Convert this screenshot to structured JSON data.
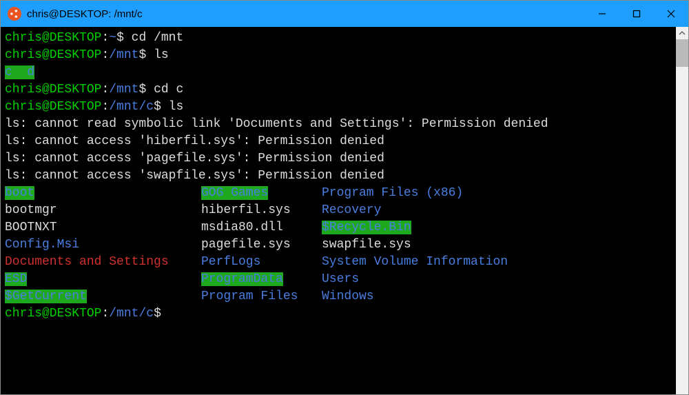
{
  "titlebar": {
    "title": "chris@DESKTOP: /mnt/c"
  },
  "prompts": {
    "p1_userhost": "chris@DESKTOP",
    "p1_sep": ":",
    "p1_path": "~",
    "p1_dollar": "$ ",
    "p1_cmd": "cd /mnt",
    "p2_path": "/mnt",
    "p2_cmd": "ls",
    "mnt_c": "c",
    "mnt_sp": "  ",
    "mnt_d": "d",
    "p3_cmd": "cd c",
    "p4_path": "/mnt/c",
    "p4_cmd": "ls"
  },
  "errors": {
    "e1": "ls: cannot read symbolic link 'Documents and Settings': Permission denied",
    "e2": "ls: cannot access 'hiberfil.sys': Permission denied",
    "e3": "ls: cannot access 'pagefile.sys': Permission denied",
    "e4": "ls: cannot access 'swapfile.sys': Permission denied"
  },
  "ls": {
    "r0c0": "boot",
    "r0c1": "GOG Games",
    "r0c2": "Program Files (x86)",
    "r1c0": "bootmgr",
    "r1c1": "hiberfil.sys",
    "r1c2": "Recovery",
    "r2c0": "BOOTNXT",
    "r2c1": "msdia80.dll",
    "r2c2": "$Recycle.Bin",
    "r3c0": "Config.Msi",
    "r3c1": "pagefile.sys",
    "r3c2": "swapfile.sys",
    "r4c0": "Documents and Settings",
    "r4c1": "PerfLogs",
    "r4c2": "System Volume Information",
    "r5c0": "ESD",
    "r5c1": "ProgramData",
    "r5c2": "Users",
    "r6c0": "$GetCurrent",
    "r6c1": "Program Files",
    "r6c2": "Windows"
  },
  "final_prompt": {
    "userhost": "chris@DESKTOP",
    "sep": ":",
    "path": "/mnt/c",
    "dollar": "$"
  }
}
